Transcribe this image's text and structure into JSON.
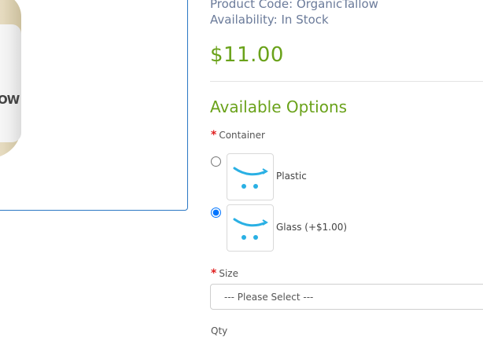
{
  "product_image": {
    "partial_text": "LOW"
  },
  "product": {
    "code_label": "Product Code: OrganicTallow",
    "availability_label": "Availability: In Stock",
    "price": "$11.00"
  },
  "options": {
    "title": "Available Options",
    "container": {
      "required_mark": "*",
      "label": "Container",
      "choices": [
        {
          "label": "Plastic",
          "selected": false
        },
        {
          "label": "Glass (+$1.00)",
          "selected": true
        }
      ]
    },
    "size": {
      "required_mark": "*",
      "label": "Size",
      "selected_text": "--- Please Select ---"
    },
    "qty_label": "Qty"
  },
  "colors": {
    "accent_green": "#6aa21a",
    "frame_blue": "#2b78c4",
    "cart_icon_cyan": "#2ab0e4",
    "required_red": "#e02020"
  }
}
